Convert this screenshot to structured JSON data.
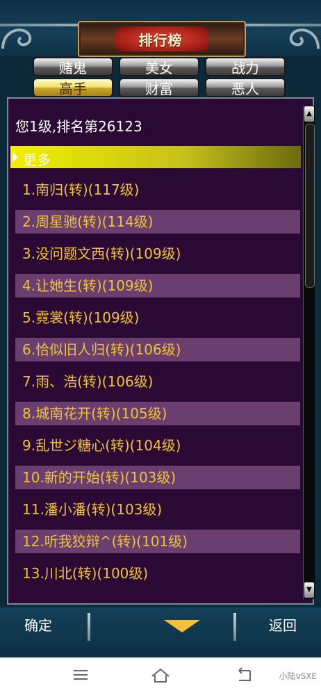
{
  "header": {
    "title": "排行榜"
  },
  "tabs": [
    {
      "label": "赌鬼",
      "active": false
    },
    {
      "label": "美女",
      "active": false
    },
    {
      "label": "战力",
      "active": false
    },
    {
      "label": "高手",
      "active": true
    },
    {
      "label": "财富",
      "active": false
    },
    {
      "label": "恶人",
      "active": false
    }
  ],
  "panel": {
    "status": "您1级,排名第26123",
    "more": "更多",
    "rows": [
      "1.南归(转)(117级)",
      "2.周星驰(转)(114级)",
      "3.没问题文西(转)(109级)",
      "4.让她生(转)(109级)",
      "5.霓裳(转)(109级)",
      "6.恰似旧人归(转)(106级)",
      "7.雨、浩(转)(106级)",
      "8.城南花开(转)(105级)",
      "9.乱世ジ糖心(转)(104级)",
      "10.新的开始(转)(103级)",
      "11.潘小潘(转)(103级)",
      "12.听我狡辩^(转)(101级)",
      "13.川北(转)(100级)"
    ]
  },
  "bottom": {
    "confirm": "确定",
    "back": "返回"
  },
  "navbar": {
    "watermark": "小陆vSXE"
  },
  "colors": {
    "panel_bg": "#2a0a34",
    "row_alt_bg": "#6a3f6f",
    "row_text": "#f0c23a",
    "more_bg": "#f0f000"
  }
}
